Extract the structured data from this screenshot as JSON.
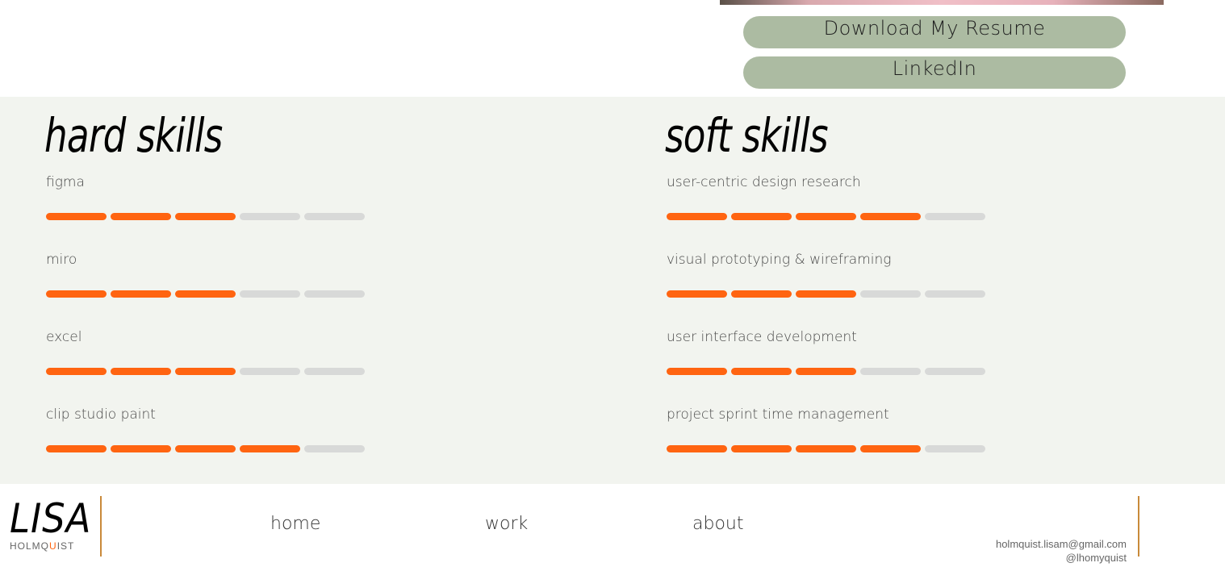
{
  "top": {
    "buttons": {
      "resume": "Download My Resume",
      "linkedin": "LinkedIn"
    }
  },
  "hard_skills": {
    "title": "hard skills",
    "items": [
      {
        "label": "figma",
        "level": 3,
        "max": 5
      },
      {
        "label": "miro",
        "level": 3,
        "max": 5
      },
      {
        "label": "excel",
        "level": 3,
        "max": 5
      },
      {
        "label": "clip studio paint",
        "level": 4,
        "max": 5
      }
    ]
  },
  "soft_skills": {
    "title": "soft skills",
    "items": [
      {
        "label": "user-centric design research",
        "level": 4,
        "max": 5
      },
      {
        "label": "visual prototyping & wireframing",
        "level": 3,
        "max": 5
      },
      {
        "label": "user interface development",
        "level": 3,
        "max": 5
      },
      {
        "label": "project sprint time management",
        "level": 4,
        "max": 5
      }
    ]
  },
  "footer": {
    "logo_main": "LISA",
    "logo_sub_before": "HOLMQ",
    "logo_sub_highlight": "U",
    "logo_sub_after": "IST",
    "nav": {
      "home": "home",
      "work": "work",
      "about": "about"
    },
    "email": "holmquist.lisam@gmail.com",
    "handle": "@lhomyquist"
  },
  "colors": {
    "accent": "#ff6411",
    "button_bg": "#acbba2",
    "skills_bg": "#f2f4ef",
    "bar_empty": "#d8d9d8"
  }
}
